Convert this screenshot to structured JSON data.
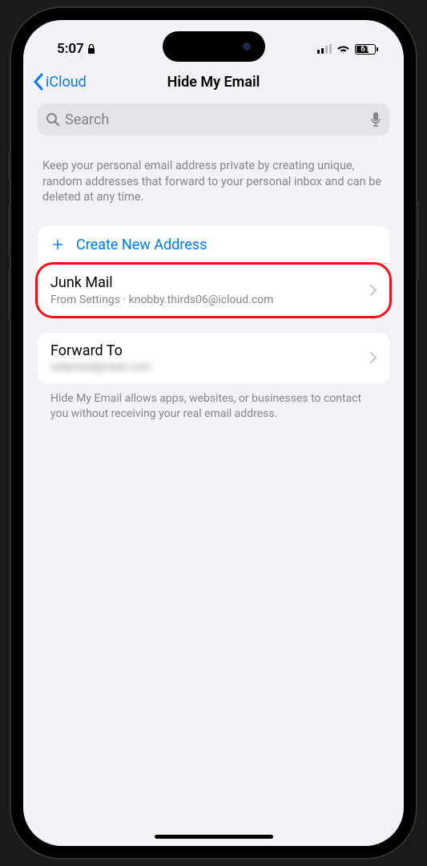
{
  "status_bar": {
    "time": "5:07",
    "battery_percent": "61"
  },
  "nav": {
    "back_label": "iCloud",
    "title": "Hide My Email"
  },
  "search": {
    "placeholder": "Search"
  },
  "description": "Keep your personal email address private by creating unique, random addresses that forward to your personal inbox and can be deleted at any time.",
  "create_action": {
    "label": "Create New Address"
  },
  "addresses": [
    {
      "title": "Junk Mail",
      "subtitle": "From Settings · knobby.thirds06@icloud.com"
    }
  ],
  "forward": {
    "label": "Forward To",
    "email_redacted": "redacted@mail.com"
  },
  "footer": "Hide My Email allows apps, websites, or businesses to contact you without receiving your real email address."
}
